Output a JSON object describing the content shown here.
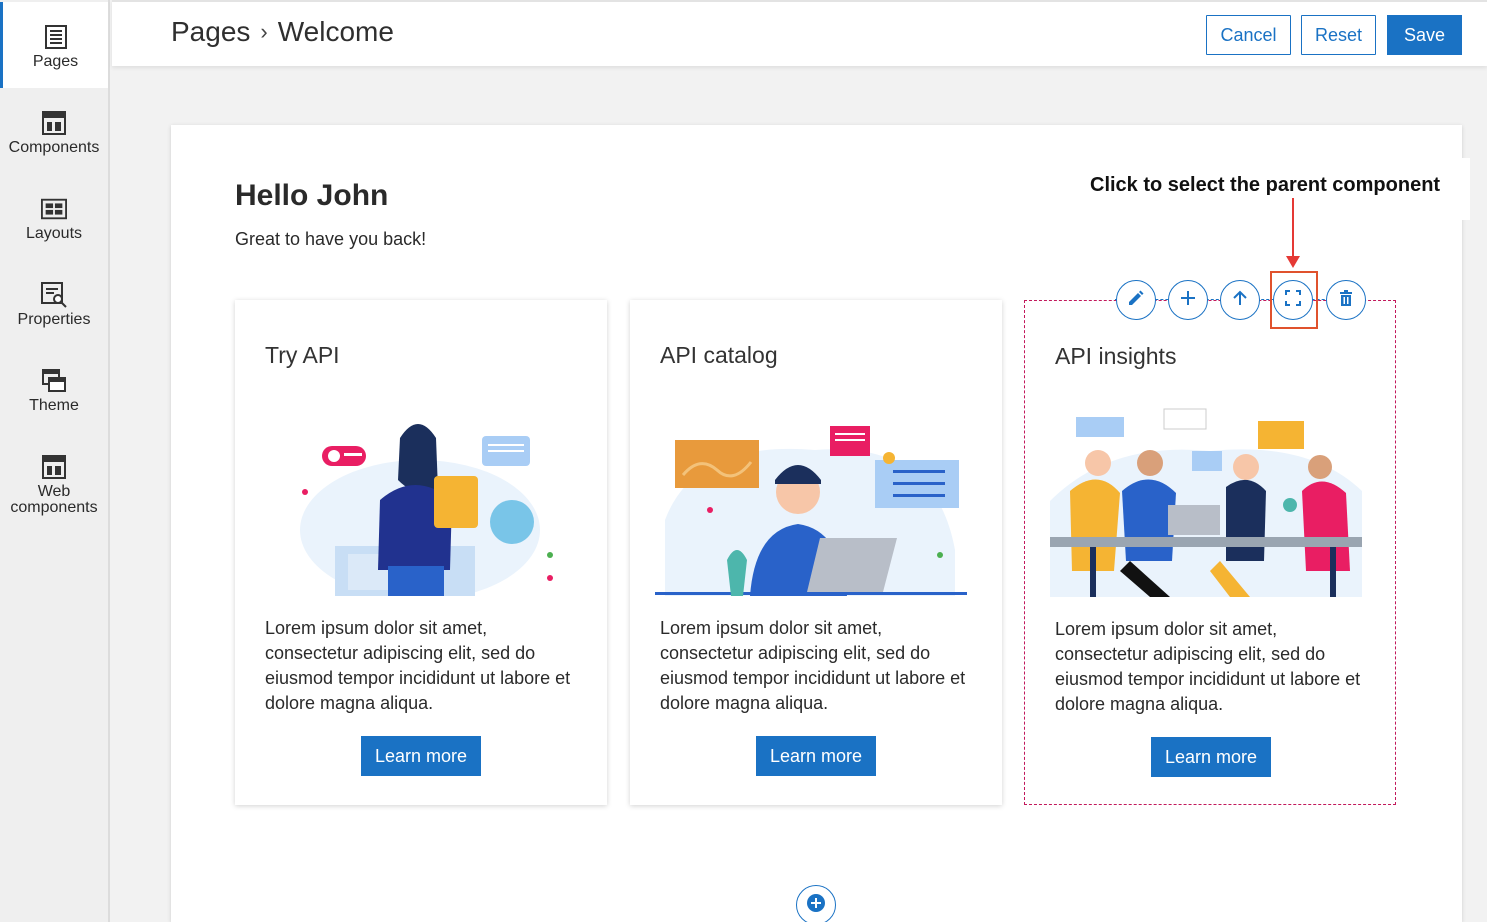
{
  "sidebar": {
    "items": [
      {
        "label": "Pages",
        "icon": "pages-icon",
        "active": true
      },
      {
        "label": "Components",
        "icon": "components-icon"
      },
      {
        "label": "Layouts",
        "icon": "layouts-icon"
      },
      {
        "label": "Properties",
        "icon": "properties-icon"
      },
      {
        "label": "Theme",
        "icon": "theme-icon"
      },
      {
        "label": "Web\ncomponents",
        "icon": "web-components-icon"
      }
    ]
  },
  "header": {
    "breadcrumb_root": "Pages",
    "breadcrumb_separator": "›",
    "breadcrumb_current": "Welcome",
    "cancel_label": "Cancel",
    "reset_label": "Reset",
    "save_label": "Save"
  },
  "page": {
    "greeting": "Hello John",
    "subgreeting": "Great to have you back!"
  },
  "cards": [
    {
      "title": "Try API",
      "body": "Lorem ipsum dolor sit amet, consectetur adipiscing elit, sed do eiusmod tempor incididunt ut labore et dolore magna aliqua.",
      "button": "Learn more"
    },
    {
      "title": "API catalog",
      "body": "Lorem ipsum dolor sit amet, consectetur adipiscing elit, sed do eiusmod tempor incididunt ut labore et dolore magna aliqua.",
      "button": "Learn more"
    },
    {
      "title": "API insights",
      "body": "Lorem ipsum dolor sit amet, consectetur adipiscing elit, sed do eiusmod tempor incididunt ut labore et dolore magna aliqua.",
      "button": "Learn more",
      "selected": true
    }
  ],
  "component_toolbar": {
    "tools": [
      "edit-icon",
      "add-icon",
      "move-up-icon",
      "select-parent-icon",
      "delete-icon"
    ]
  },
  "annotation": {
    "callout_text": "Click to select the parent component"
  },
  "colors": {
    "accent": "#1a72c4",
    "selection": "#c2185b",
    "highlight": "#e0522d",
    "arrow": "#e53935"
  }
}
